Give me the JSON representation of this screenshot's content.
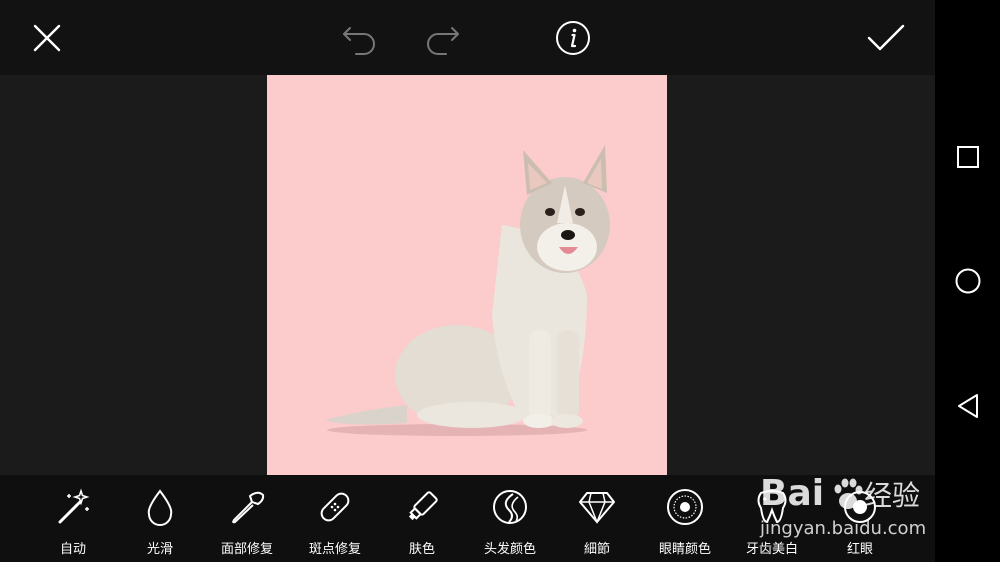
{
  "topbar": {
    "icons": [
      "close-icon",
      "undo-icon",
      "redo-icon",
      "info-icon",
      "check-icon"
    ]
  },
  "tools": [
    {
      "label": "自动",
      "icon": "magic-wand-icon"
    },
    {
      "label": "光滑",
      "icon": "droplet-icon"
    },
    {
      "label": "面部修复",
      "icon": "makeup-brush-icon"
    },
    {
      "label": "斑点修复",
      "icon": "bandage-icon"
    },
    {
      "label": "肤色",
      "icon": "tube-icon"
    },
    {
      "label": "头发颜色",
      "icon": "hair-icon"
    },
    {
      "label": "細節",
      "icon": "diamond-icon"
    },
    {
      "label": "眼睛颜色",
      "icon": "eye-iris-icon"
    },
    {
      "label": "牙齿美白",
      "icon": "tooth-icon"
    },
    {
      "label": "红眼",
      "icon": "red-eye-icon"
    }
  ],
  "navbar": {
    "icons": [
      "recent-apps-icon",
      "home-icon",
      "back-icon"
    ]
  },
  "watermark": {
    "url": "jingyan.baidu.com"
  },
  "colors": {
    "photo_background": "#fccbcc",
    "toolbar": "#0f0f0f",
    "canvas": "#1b1b1b"
  }
}
